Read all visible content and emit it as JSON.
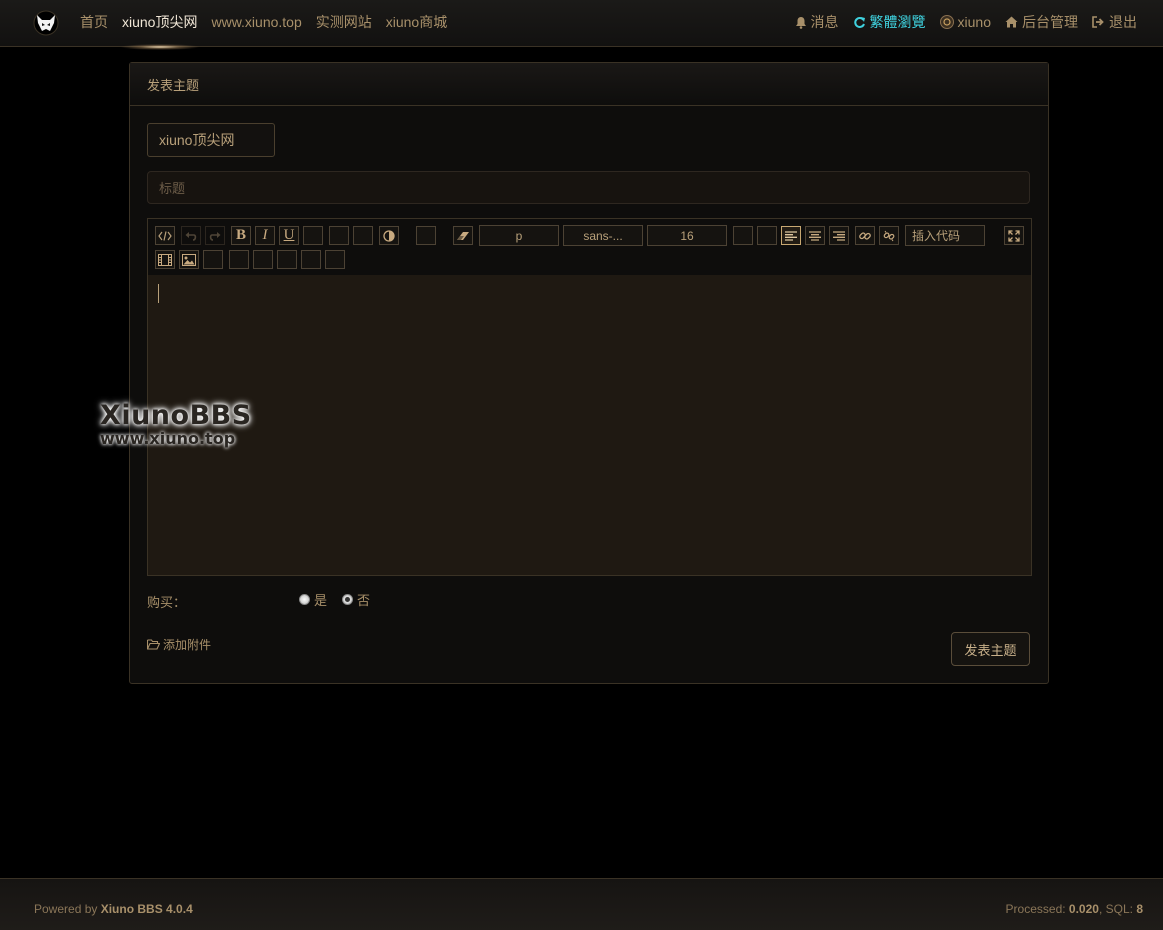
{
  "nav": {
    "items": [
      {
        "label": "首页"
      },
      {
        "label": "xiuno顶尖网"
      },
      {
        "label": "www.xiuno.top"
      },
      {
        "label": "实测网站"
      },
      {
        "label": "xiuno商城"
      }
    ],
    "right": {
      "messages": "消息",
      "traditional": "繁體瀏覽",
      "user": "xiuno",
      "admin": "后台管理",
      "logout": "退出"
    },
    "colors": {
      "accent_cyan": "#3fd1de",
      "active": "#f0e6d6"
    }
  },
  "form": {
    "header": "发表主题",
    "forum": "xiuno顶尖网",
    "title_placeholder": "标题",
    "toolbar": {
      "format": "p",
      "font": "sans-...",
      "size": "16",
      "insert_code": "插入代码"
    },
    "buy_label": "购买：",
    "buy_yes": "是",
    "buy_no": "否",
    "buy_selected": "否",
    "attach": "添加附件",
    "submit": "发表主题"
  },
  "watermark": {
    "line1": "XiunoBBS",
    "line2": "www.xiuno.top"
  },
  "footer": {
    "powered": "Powered by",
    "brand": "Xiuno BBS 4.0.4",
    "processed_label": "Processed:",
    "processed_value": "0.020",
    "sql_label": ", SQL:",
    "sql_value": "8"
  }
}
